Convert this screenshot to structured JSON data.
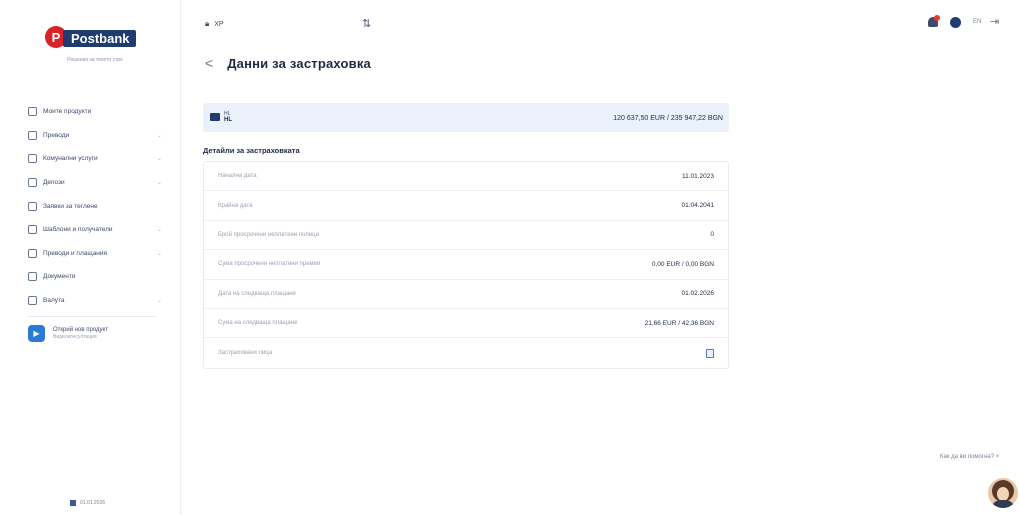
{
  "brand": {
    "name": "Postbank",
    "letter": "P",
    "tagline": "Решения за твоето утре"
  },
  "sidebar": {
    "items": [
      {
        "label": "Моите продукти",
        "icon": "products-icon",
        "chevron": false
      },
      {
        "label": "Преводи",
        "icon": "transfer-icon",
        "chevron": true
      },
      {
        "label": "Комунални услуги",
        "icon": "utilities-icon",
        "chevron": true
      },
      {
        "label": "Депози",
        "icon": "deposits-icon",
        "chevron": true
      },
      {
        "label": "Заявки за теглене",
        "icon": "withdrawal-icon",
        "chevron": false
      },
      {
        "label": "Шаблони и получатели",
        "icon": "templates-icon",
        "chevron": true
      },
      {
        "label": "Преводи и плащания",
        "icon": "payments-icon",
        "chevron": true
      },
      {
        "label": "Документи",
        "icon": "documents-icon",
        "chevron": false
      },
      {
        "label": "Валута",
        "icon": "currency-icon",
        "chevron": true
      }
    ],
    "promo": {
      "title": "Открий нов продукт",
      "subtitle": "Видеоконсултация"
    },
    "footer": "01.01.2026"
  },
  "topbar": {
    "store": "ХР",
    "lang": "EN"
  },
  "page": {
    "back": "<",
    "title": "Данни за застраховка"
  },
  "summary": {
    "account_top": "HL",
    "account_main": "HL",
    "amount": "120 637,50 EUR / 235 947,22 BGN"
  },
  "section_title": "Детайли за застраховката",
  "details": [
    {
      "label": "Начална дата",
      "value": "11.01.2023"
    },
    {
      "label": "Крайна дата",
      "value": "01.04.2041"
    },
    {
      "label": "Брой просрочени неплатени полици",
      "value": "0"
    },
    {
      "label": "Сума просрочени неплатени премии",
      "value": "0,00 EUR / 0,00 BGN"
    },
    {
      "label": "Дата на следваща плащане",
      "value": "01.02.2026"
    },
    {
      "label": "Сума на следваща плащане",
      "value": "21,66 EUR / 42,36 BGN"
    },
    {
      "label": "Застраховани лица",
      "value": ""
    }
  ],
  "help": {
    "label": "Как да ви помогна? ×"
  },
  "colors": {
    "brand_red": "#d8232a",
    "brand_navy": "#1f3b70",
    "summary_bg": "#eaf1fa"
  }
}
